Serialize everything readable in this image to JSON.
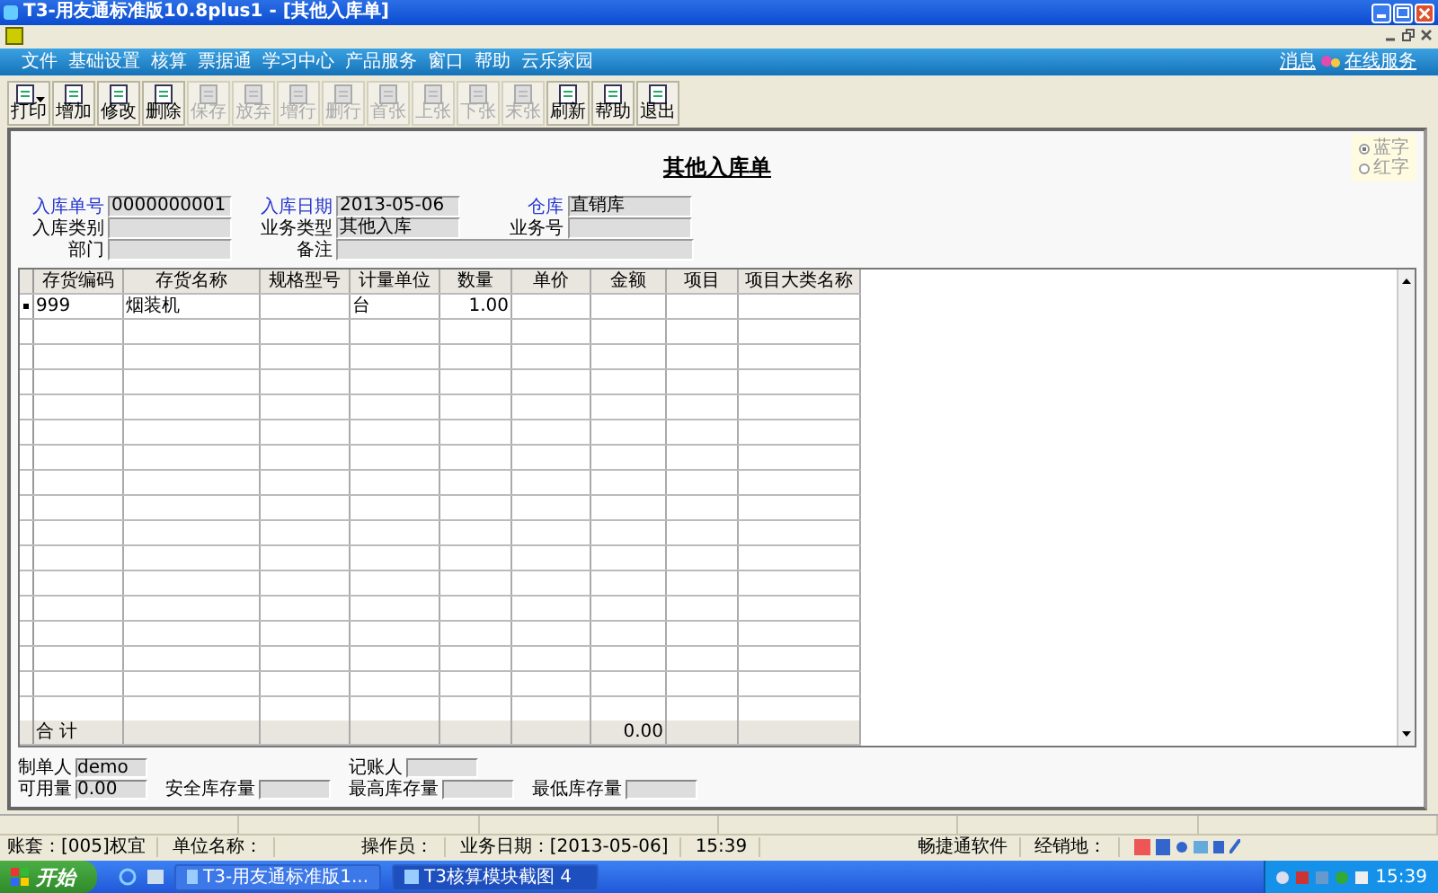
{
  "window": {
    "title": "T3-用友通标准版10.8plus1 - [其他入库单]"
  },
  "menu": {
    "items": [
      "文件",
      "基础设置",
      "核算",
      "票据通",
      "学习中心",
      "产品服务",
      "窗口",
      "帮助",
      "云乐家园"
    ],
    "links": [
      "消息",
      "在线服务"
    ]
  },
  "toolbar": [
    {
      "label": "打印",
      "disabled": false,
      "dropdown": true
    },
    {
      "label": "增加",
      "disabled": false,
      "dropdown": false
    },
    {
      "label": "修改",
      "disabled": false,
      "dropdown": false
    },
    {
      "label": "删除",
      "disabled": false,
      "dropdown": false
    },
    {
      "label": "保存",
      "disabled": true,
      "dropdown": false
    },
    {
      "label": "放弃",
      "disabled": true,
      "dropdown": false
    },
    {
      "label": "增行",
      "disabled": true,
      "dropdown": false
    },
    {
      "label": "删行",
      "disabled": true,
      "dropdown": false
    },
    {
      "label": "首张",
      "disabled": true,
      "dropdown": false
    },
    {
      "label": "上张",
      "disabled": true,
      "dropdown": false
    },
    {
      "label": "下张",
      "disabled": true,
      "dropdown": false
    },
    {
      "label": "末张",
      "disabled": true,
      "dropdown": false
    },
    {
      "label": "刷新",
      "disabled": false,
      "dropdown": false
    },
    {
      "label": "帮助",
      "disabled": false,
      "dropdown": false
    },
    {
      "label": "退出",
      "disabled": false,
      "dropdown": false
    }
  ],
  "form": {
    "title": "其他入库单",
    "color_options": [
      {
        "label": "蓝字",
        "selected": true
      },
      {
        "label": "红字",
        "selected": false
      }
    ],
    "header_fields": [
      {
        "label": "入库单号",
        "value": "0000000001",
        "required": true
      },
      {
        "label": "入库日期",
        "value": "2013-05-06",
        "required": true
      },
      {
        "label": "仓库",
        "value": "直销库",
        "required": true
      },
      {
        "label": "入库类别",
        "required": false
      },
      {
        "label": "业务类型",
        "value": "其他入库",
        "required": false
      },
      {
        "label": "业务号",
        "required": false
      },
      {
        "label": "部门",
        "required": false
      },
      {
        "label": "备注",
        "required": false
      }
    ],
    "table": {
      "columns": [
        "存货编码",
        "存货名称",
        "规格型号",
        "计量单位",
        "数量",
        "单价",
        "金额",
        "项目",
        "项目大类名称"
      ],
      "rows": [
        {
          "selected": true,
          "cells": [
            "999",
            "烟装机",
            "",
            "台",
            "1.00",
            "",
            "",
            "",
            ""
          ]
        }
      ],
      "total": {
        "label": "合  计",
        "cells": [
          "",
          "",
          "",
          "",
          "",
          "",
          "0.00",
          "",
          ""
        ]
      }
    },
    "footer_fields": [
      {
        "label": "制单人",
        "value": "demo"
      },
      {
        "label": "记账人"
      },
      {
        "label": "可用量",
        "value": "0.00"
      },
      {
        "label": "安全库存量"
      },
      {
        "label": "最高库存量"
      },
      {
        "label": "最低库存量"
      }
    ]
  },
  "status_bar": [
    "账套：[005]权宜",
    "单位名称：",
    "操作员：",
    "业务日期：[2013-05-06]",
    "15:39",
    "畅捷通软件",
    "经销地："
  ],
  "taskbar": {
    "start": "开始",
    "tasks": [
      "T3-用友通标准版1...",
      "T3核算模块截图 4"
    ],
    "clock": "15:39"
  }
}
